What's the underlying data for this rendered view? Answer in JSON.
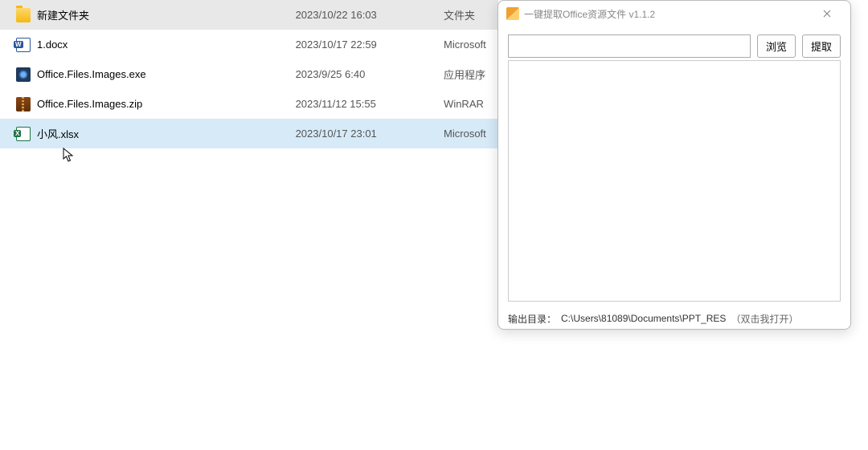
{
  "file_list": {
    "rows": [
      {
        "icon": "folder-icon",
        "name": "新建文件夹",
        "date": "2023/10/22 16:03",
        "type": "文件夹",
        "state": "selected"
      },
      {
        "icon": "docx-icon",
        "name": "1.docx",
        "date": "2023/10/17 22:59",
        "type": "Microsoft",
        "state": ""
      },
      {
        "icon": "exe-icon",
        "name": "Office.Files.Images.exe",
        "date": "2023/9/25 6:40",
        "type": "应用程序",
        "state": ""
      },
      {
        "icon": "zip-icon",
        "name": "Office.Files.Images.zip",
        "date": "2023/11/12 15:55",
        "type": "WinRAR",
        "state": ""
      },
      {
        "icon": "xlsx-icon",
        "name": "小风.xlsx",
        "date": "2023/10/17 23:01",
        "type": "Microsoft",
        "state": "hover"
      }
    ]
  },
  "dialog": {
    "title": "一键提取Office资源文件 v1.1.2",
    "browse_label": "浏览",
    "extract_label": "提取",
    "path_value": "",
    "status_label": "输出目录：",
    "status_path": "C:\\Users\\81089\\Documents\\PPT_RES",
    "status_hint": "（双击我打开）"
  }
}
